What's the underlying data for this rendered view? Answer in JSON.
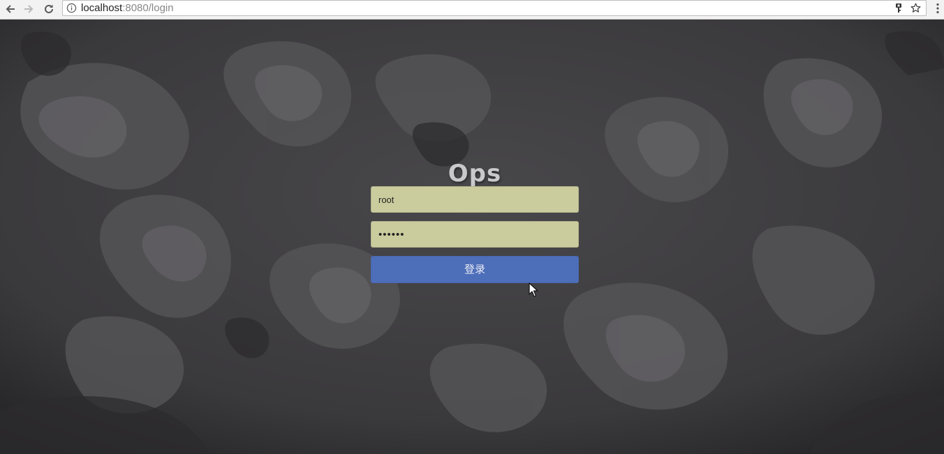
{
  "browser": {
    "url_host": "localhost",
    "url_path": ":8080/login",
    "icons": {
      "back": "arrow-left-icon",
      "forward": "arrow-right-icon",
      "reload": "reload-icon",
      "info": "info-icon",
      "key": "key-icon",
      "bookmark": "star-icon",
      "menu": "kebab-menu-icon"
    }
  },
  "login": {
    "title": "Ops",
    "username_value": "root",
    "password_value": "••••••",
    "submit_label": "登录"
  },
  "colors": {
    "background": "#3c3b3e",
    "title": "#c9c9cb",
    "input_fill": "#cacc9e",
    "button": "#4d6eb9",
    "button_text": "#e9ecf5"
  }
}
